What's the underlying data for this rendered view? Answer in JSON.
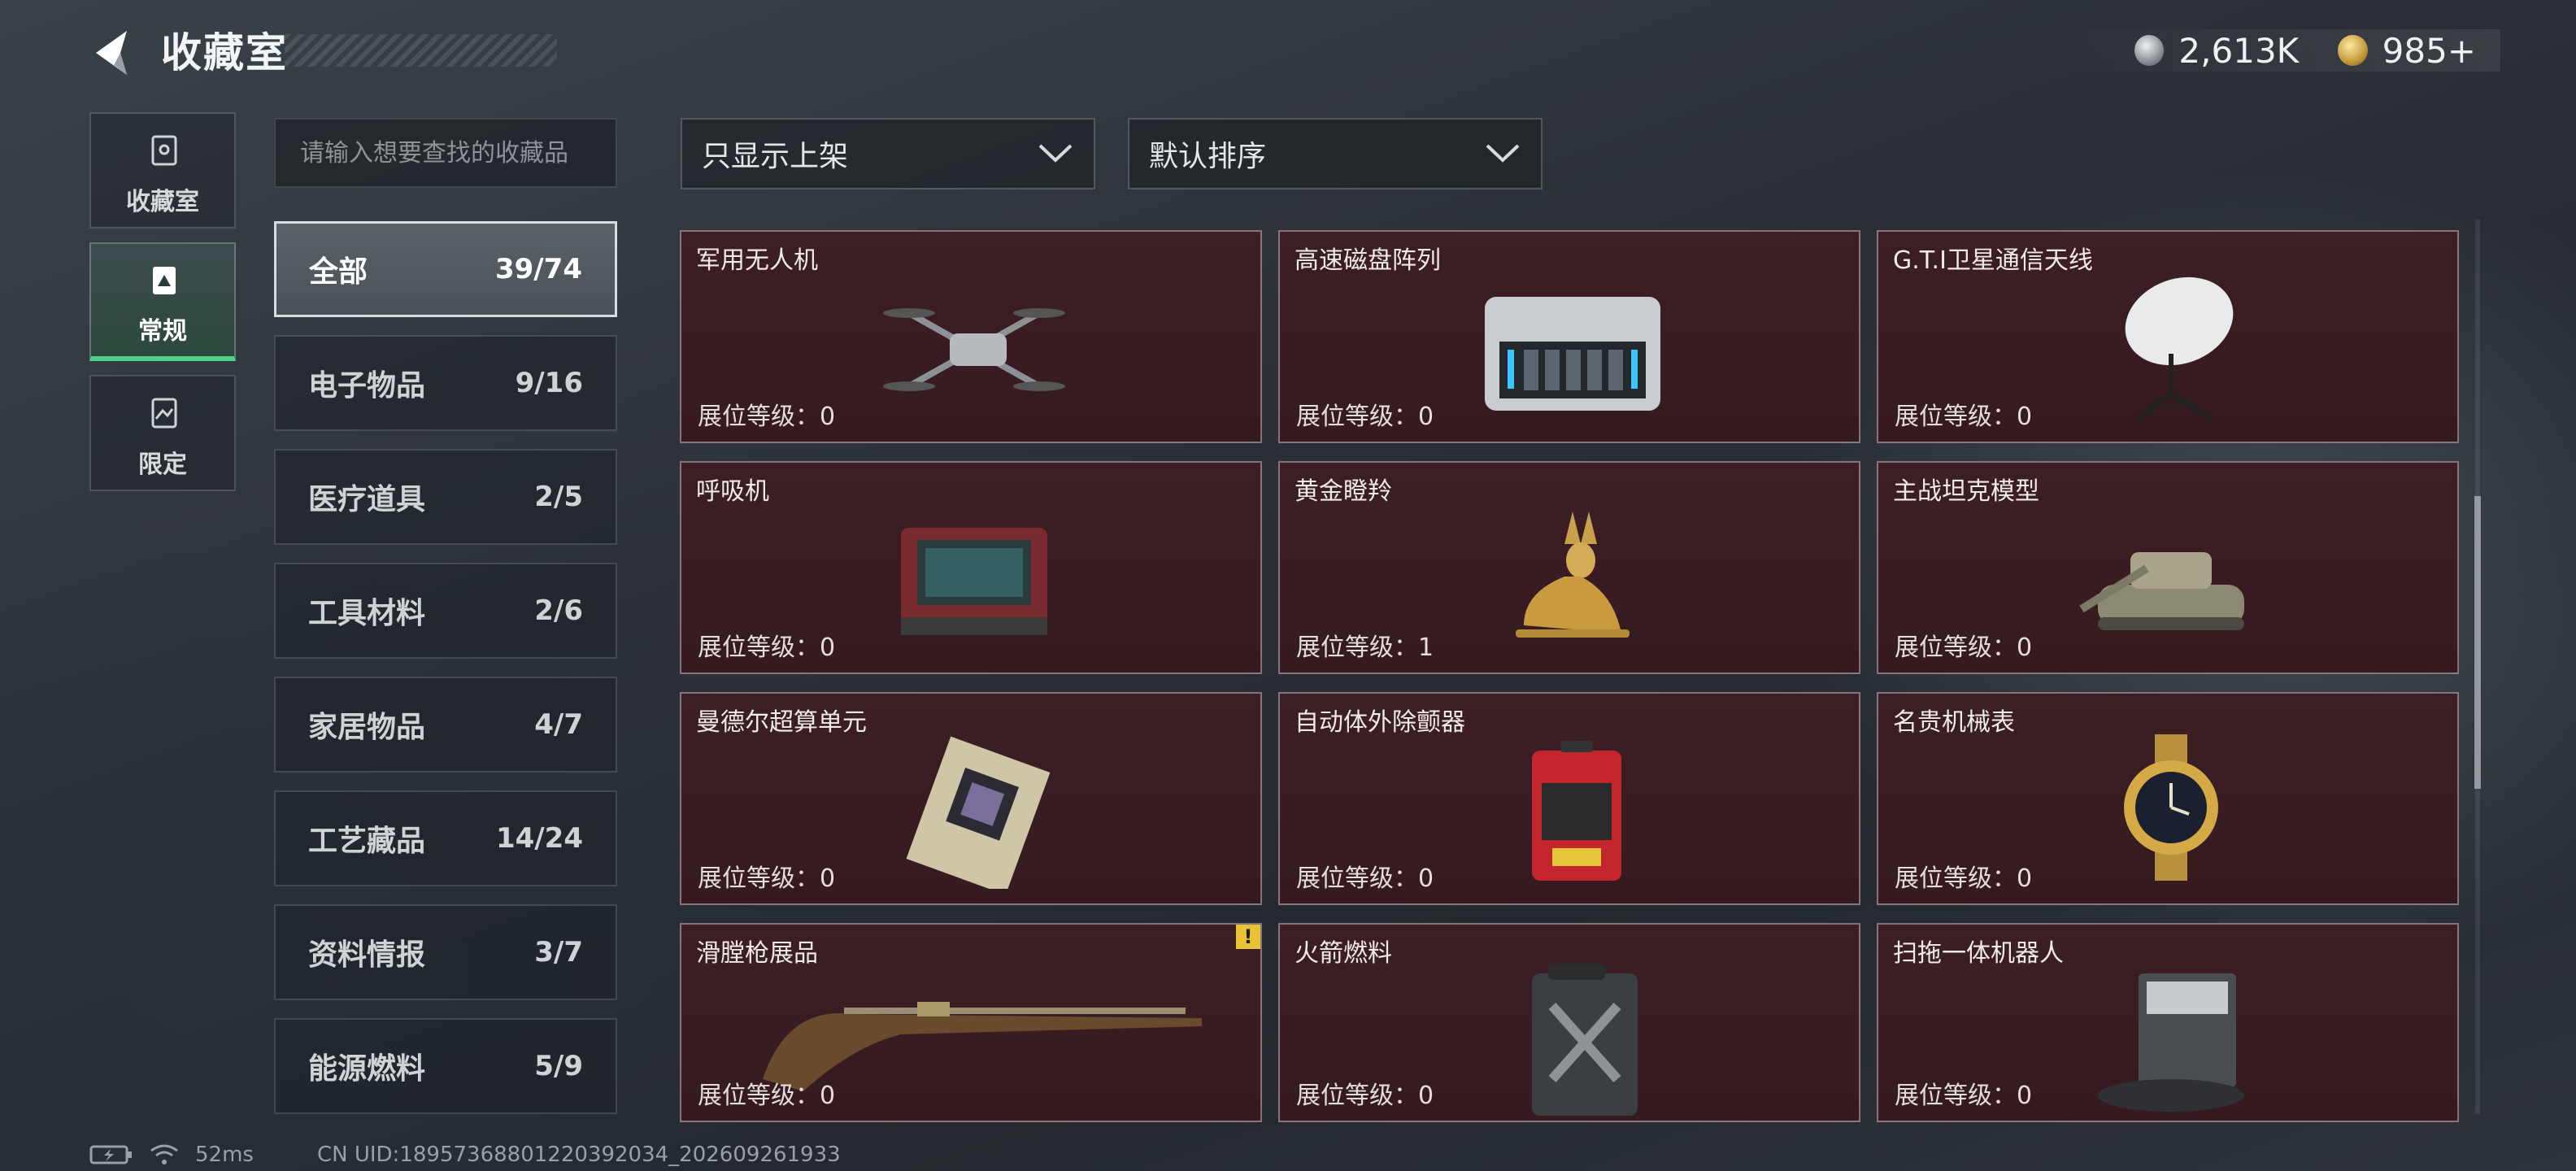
{
  "header": {
    "title": "收藏室",
    "currency": [
      {
        "icon": "silver-coin-icon",
        "value": "2,613K"
      },
      {
        "icon": "gold-coin-icon",
        "value": "985+"
      }
    ]
  },
  "left_nav": [
    {
      "label": "收藏室",
      "icon": "collection-room-icon",
      "active": false
    },
    {
      "label": "常规",
      "icon": "regular-icon",
      "active": true
    },
    {
      "label": "限定",
      "icon": "limited-icon",
      "active": false
    }
  ],
  "search": {
    "placeholder": "请输入想要查找的收藏品"
  },
  "categories": [
    {
      "name": "全部",
      "count": "39/74",
      "active": true
    },
    {
      "name": "电子物品",
      "count": "9/16"
    },
    {
      "name": "医疗道具",
      "count": "2/5"
    },
    {
      "name": "工具材料",
      "count": "2/6"
    },
    {
      "name": "家居物品",
      "count": "4/7"
    },
    {
      "name": "工艺藏品",
      "count": "14/24"
    },
    {
      "name": "资料情报",
      "count": "3/7"
    },
    {
      "name": "能源燃料",
      "count": "5/9"
    }
  ],
  "filters": {
    "shelf_filter": "只显示上架",
    "sort": "默认排序"
  },
  "level_label": "展位等级：",
  "items": [
    {
      "name": "军用无人机",
      "level": "0",
      "icon": "drone-icon"
    },
    {
      "name": "高速磁盘阵列",
      "level": "0",
      "icon": "disk-array-icon"
    },
    {
      "name": "G.T.I卫星通信天线",
      "level": "0",
      "icon": "satellite-dish-icon"
    },
    {
      "name": "呼吸机",
      "level": "0",
      "icon": "ventilator-icon"
    },
    {
      "name": "黄金瞪羚",
      "level": "1",
      "icon": "golden-gazelle-icon"
    },
    {
      "name": "主战坦克模型",
      "level": "0",
      "icon": "tank-model-icon"
    },
    {
      "name": "曼德尔超算单元",
      "level": "0",
      "icon": "supercomputer-unit-icon"
    },
    {
      "name": "自动体外除颤器",
      "level": "0",
      "icon": "defibrillator-icon"
    },
    {
      "name": "名贵机械表",
      "level": "0",
      "icon": "luxury-watch-icon"
    },
    {
      "name": "滑膛枪展品",
      "level": "0",
      "icon": "musket-icon",
      "warning": "!"
    },
    {
      "name": "火箭燃料",
      "level": "0",
      "icon": "fuel-can-icon"
    },
    {
      "name": "扫拖一体机器人",
      "level": "0",
      "icon": "robot-vacuum-icon"
    }
  ],
  "footer": {
    "ping": "52ms",
    "uid": "CN UID:18957368801220392034_202609261933"
  }
}
